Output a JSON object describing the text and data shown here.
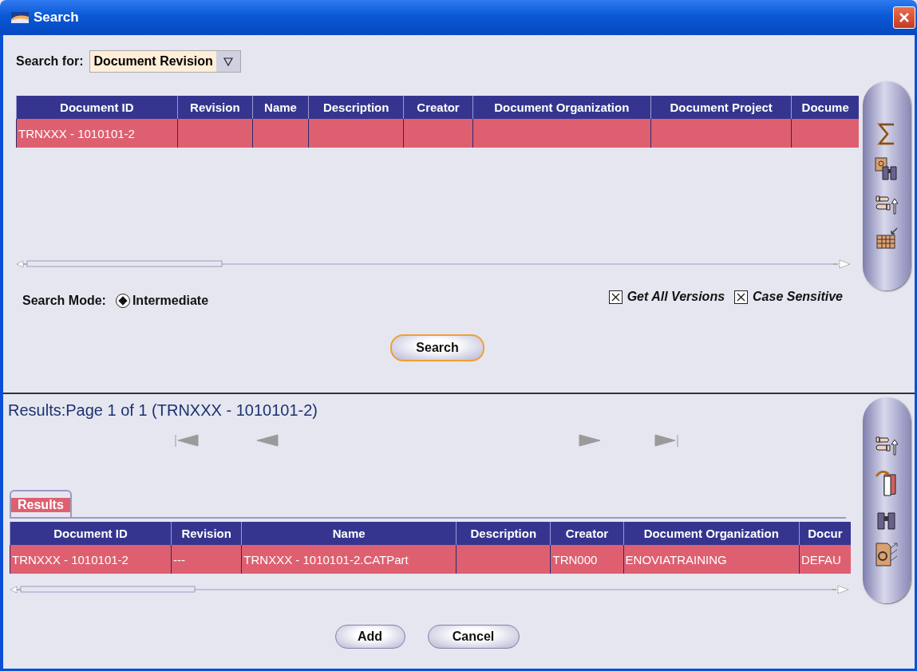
{
  "window": {
    "title": "Search"
  },
  "search_for": {
    "label": "Search for:",
    "value": "Document Revision"
  },
  "criteria_table": {
    "columns": [
      "Document ID",
      "Revision",
      "Name",
      "Description",
      "Creator",
      "Document Organization",
      "Document Project",
      "Docume"
    ],
    "rows": [
      {
        "selected": true,
        "cells": [
          "TRNXXX - 1010101-2"
        ]
      }
    ]
  },
  "search_mode": {
    "label": "Search Mode:",
    "options": [
      {
        "label": "Intermediate",
        "selected": true
      }
    ]
  },
  "options": [
    {
      "label": "Get All Versions",
      "checked": true
    },
    {
      "label": "Case Sensitive",
      "checked": true
    }
  ],
  "search_button": "Search",
  "results": {
    "title": "Results:Page 1 of 1 (TRNXXX - 1010101-2)",
    "nav": [
      {
        "kind": "first",
        "disabled": true
      },
      {
        "kind": "previous",
        "disabled": true
      },
      {
        "kind": "next",
        "disabled": true
      },
      {
        "kind": "last",
        "disabled": true
      }
    ],
    "tabs": [
      {
        "label": "Results",
        "selected": true
      }
    ],
    "table": {
      "columns": [
        "Document ID",
        "Revision",
        "Name",
        "Description",
        "Creator",
        "Document Organization",
        "Docur"
      ],
      "rows": [
        {
          "selected": true,
          "cells": [
            "TRNXXX - 1010101-2",
            "---",
            "TRNXXX - 1010101-2.CATPart",
            null,
            "TRN000",
            "ENOVIATRAINING",
            "DEFAU"
          ]
        }
      ]
    }
  },
  "buttons": [
    "Add",
    "Cancel"
  ]
}
